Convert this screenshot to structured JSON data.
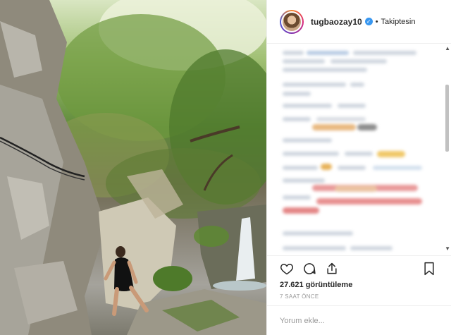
{
  "post": {
    "username": "tugbaozay10",
    "follow_status": "Takiptesin",
    "separator": "•",
    "views": "27.621 görüntüleme",
    "time_ago": "7 SAAT ÖNCE",
    "comment_placeholder": "Yorum ekle..."
  },
  "icons": {
    "verified": "verified-badge-icon",
    "like": "heart-icon",
    "comment": "speech-bubble-icon",
    "share": "share-icon",
    "save": "bookmark-icon"
  },
  "colors": {
    "verified": "#3897f0",
    "text": "#262626",
    "muted": "#999999"
  }
}
